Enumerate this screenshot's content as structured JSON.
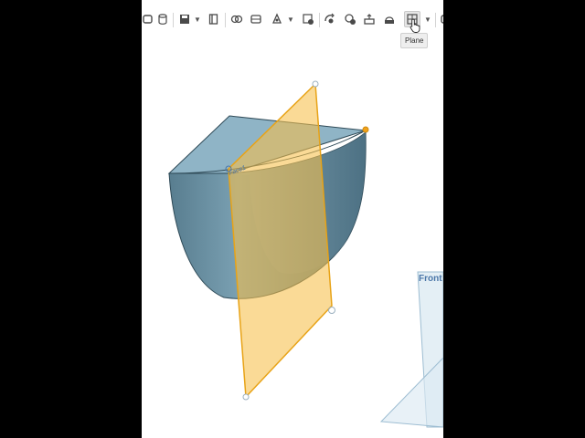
{
  "toolbar": {
    "tooltip": "Plane",
    "icons": [
      "cylinder-icon",
      "save-icon",
      "book-icon",
      "boolean-icon",
      "sketch-icon",
      "transform-icon",
      "delete-part-icon",
      "revolve-icon",
      "split-icon",
      "extrude-icon",
      "loft-icon",
      "plane-icon",
      "more-icon"
    ]
  },
  "viewport": {
    "face_label": "Face1",
    "plane_label": "Front",
    "colors": {
      "part_face": "#8fb4c6",
      "part_side": "#5f8496",
      "new_plane": "#f7c04a",
      "new_plane_edge": "#e8a317",
      "front_plane": "#c3dbe9",
      "front_plane_edge": "#8fb6cf"
    }
  }
}
